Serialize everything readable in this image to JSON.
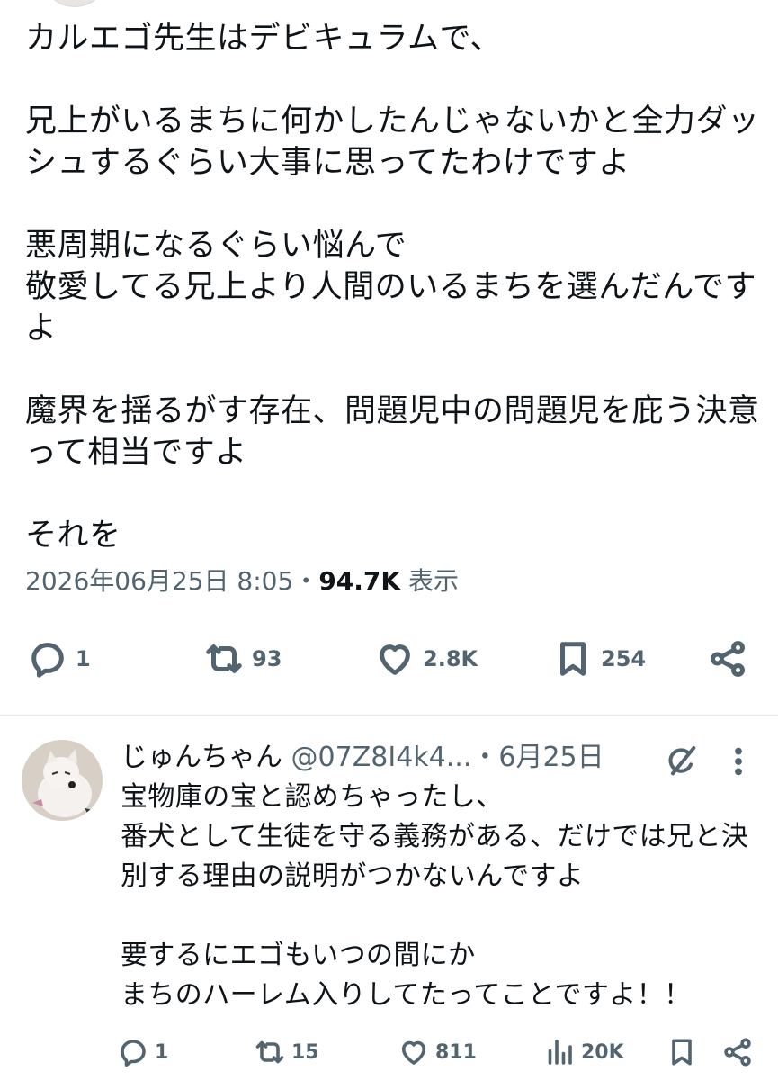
{
  "tweet": {
    "paragraphs": [
      "カルエゴ先生はデビキュラムで、",
      "兄上がいるまちに何かしたんじゃないかと全力ダッシュするぐらい大事に思ってたわけですよ",
      "悪周期になるぐらい悩んで\n敬愛してる兄上より人間のいるまちを選んだんですよ",
      "魔界を揺るがす存在、問題児中の問題児を庇う決意って相当ですよ",
      "それを"
    ],
    "timestamp": "2026年06月25日 8:05",
    "separator": "・",
    "views": "94.7K",
    "views_label": "表示",
    "actions": {
      "reply_count": "1",
      "retweet_count": "93",
      "like_count": "2.8K",
      "bookmark_count": "254"
    },
    "icons": [
      "reply-icon",
      "retweet-icon",
      "like-icon",
      "bookmark-icon",
      "share-icon"
    ]
  },
  "reply": {
    "name": "じゅんちゃん",
    "handle": "@07Z8I4k4...",
    "dot": "・",
    "date": "6月25日",
    "paragraphs": [
      "宝物庫の宝と認めちゃったし、\n番犬として生徒を守る義務がある、だけでは兄と決別する理由の説明がつかないんですよ",
      "要するにエゴもいつの間にか\nまちのハーレム入りしてたってことですよ！！"
    ],
    "actions": {
      "reply_count": "1",
      "retweet_count": "15",
      "like_count": "811",
      "views_count": "20K"
    }
  },
  "colors": {
    "text": "#0f1419",
    "secondary": "#536471",
    "divider": "#e1e6ea"
  }
}
